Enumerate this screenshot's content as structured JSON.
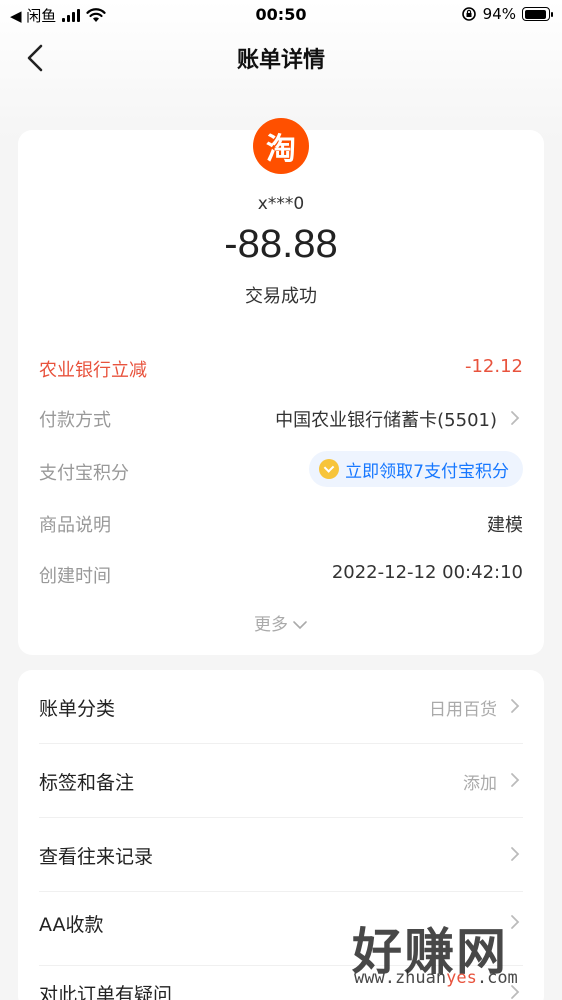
{
  "status_bar": {
    "back_app": "◀ 闲鱼",
    "time": "00:50",
    "battery": "94%",
    "battery_level": 0.94
  },
  "nav": {
    "title": "账单详情"
  },
  "bill": {
    "merchant_logo_char": "淘",
    "merchant": "x***0",
    "amount": "-88.88",
    "status": "交易成功",
    "details": [
      {
        "label": "农业银行立减",
        "value": "-12.12"
      },
      {
        "label": "付款方式",
        "value": "中国农业银行储蓄卡(5501)"
      },
      {
        "label": "支付宝积分",
        "value": "立即领取7支付宝积分"
      },
      {
        "label": "商品说明",
        "value": "建模"
      },
      {
        "label": "创建时间",
        "value": "2022-12-12 00:42:10"
      }
    ],
    "more": "更多"
  },
  "actions": [
    {
      "label": "账单分类",
      "value": "日用百货"
    },
    {
      "label": "标签和备注",
      "value": "添加"
    },
    {
      "label": "查看往来记录",
      "value": ""
    },
    {
      "label": "AA收款",
      "value": ""
    },
    {
      "label": "对此订单有疑问",
      "value": ""
    }
  ],
  "watermark": {
    "main": "好赚网",
    "url_prefix": "www.zhuan",
    "url_highlight": "yes",
    "url_suffix": ".com"
  },
  "colors": {
    "discount": "#e8533d",
    "link_blue": "#1677ff",
    "taobao_orange": "#ff5000"
  }
}
